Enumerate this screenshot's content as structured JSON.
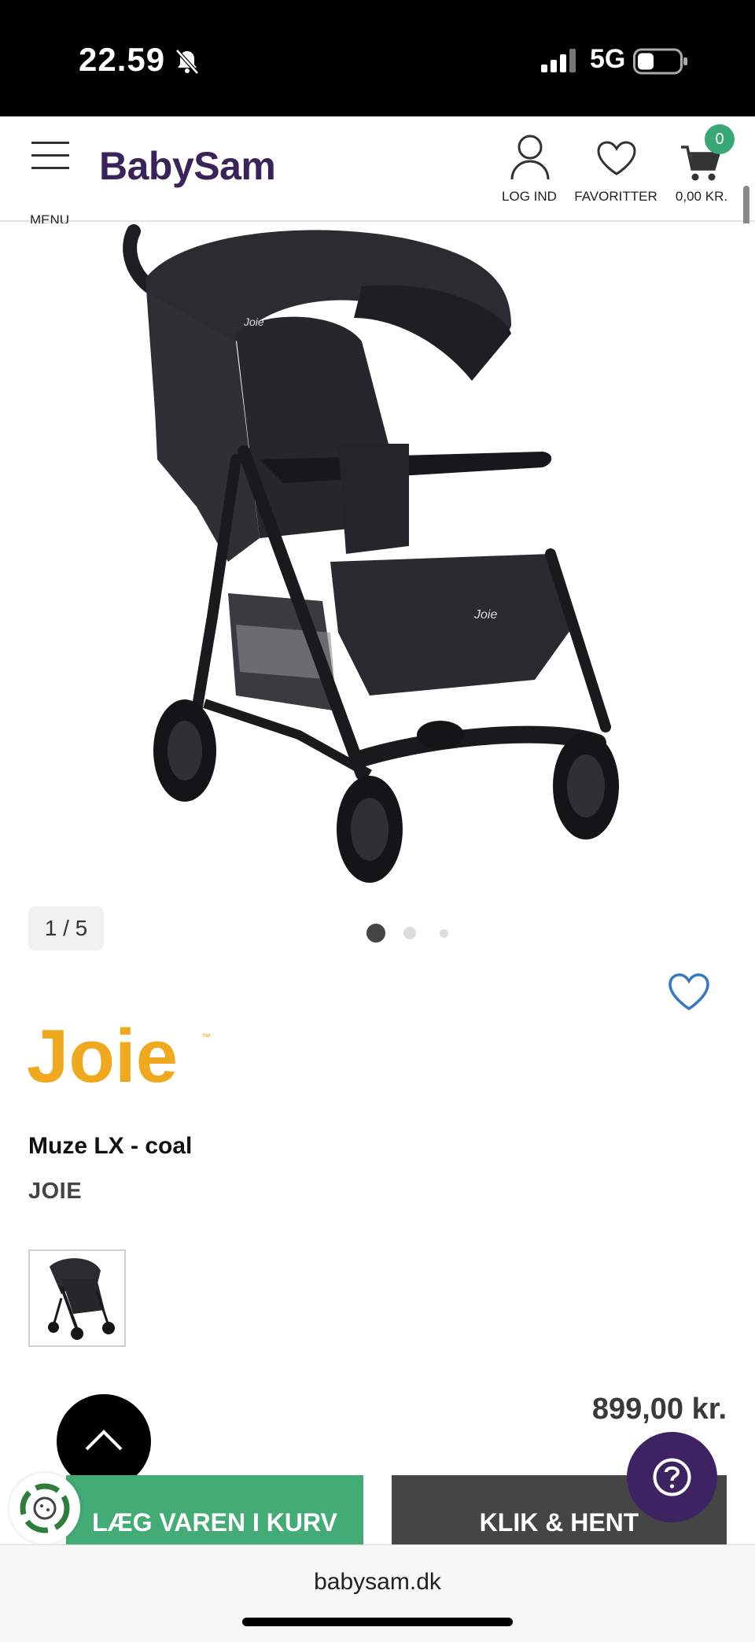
{
  "status_bar": {
    "time": "22.59",
    "network": "5G"
  },
  "header": {
    "menu_label": "MENU",
    "logo": "BabySam",
    "login_label": "LOG IND",
    "favorites_label": "FAVORITTER",
    "cart_total": "0,00 KR.",
    "cart_count": "0"
  },
  "gallery": {
    "counter": "1 / 5",
    "dots_total": 3,
    "active_dot": 1
  },
  "product": {
    "brand_logo_text": "Joie",
    "name": "Muze LX - coal",
    "brand": "JOIE",
    "price": "899,00 kr.",
    "stroller_print": "Joie"
  },
  "actions": {
    "add_to_cart": "LÆG VAREN I KURV",
    "click_collect": "KLIK & HENT"
  },
  "browser": {
    "url": "babysam.dk"
  },
  "colors": {
    "brand_purple": "#3a2358",
    "green": "#43ab76",
    "dark_button": "#454545",
    "joie_yellow": "#f0a81e",
    "help_purple": "#3d2362"
  }
}
